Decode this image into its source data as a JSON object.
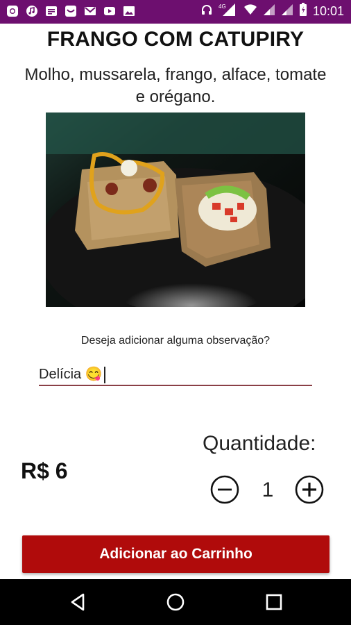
{
  "status_bar": {
    "time": "10:01",
    "network": "4G",
    "icons": [
      "whatsapp-icon",
      "music-icon",
      "message-icon",
      "messenger-icon",
      "gmail-icon",
      "youtube-icon",
      "gallery-icon",
      "headphones-icon",
      "signal-icon",
      "wifi-icon",
      "battery-icon"
    ]
  },
  "product": {
    "title": "FRANGO COM CATUPIRY",
    "description": "Molho, mussarela, frango, alface, tomate e orégano."
  },
  "observation": {
    "label": "Deseja adicionar alguma observação?",
    "value": "Delícia 😋"
  },
  "price": "R$ 6",
  "quantity": {
    "label": "Quantidade:",
    "value": "1"
  },
  "cart_button_label": "Adicionar ao Carrinho",
  "nav": [
    "back-icon",
    "home-icon",
    "recents-icon"
  ],
  "colors": {
    "status_bar": "#6d0f6f",
    "button": "#b00b0b",
    "input_underline": "#8a3f46"
  }
}
